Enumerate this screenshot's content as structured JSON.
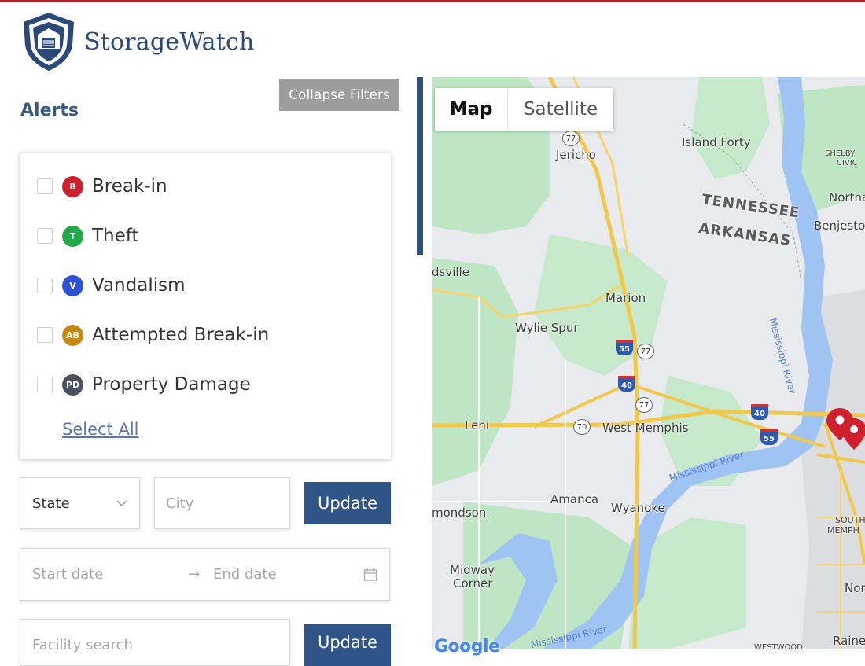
{
  "app": {
    "brand": "StorageWatch",
    "accent": "#2f5488",
    "top_bar_color": "#b3202f"
  },
  "filters": {
    "title": "Alerts",
    "collapse_label": "Collapse Filters",
    "alert_types": [
      {
        "badge": "B",
        "label": "Break-in",
        "color": "#d0202e",
        "checked": false
      },
      {
        "badge": "T",
        "label": "Theft",
        "color": "#23a84a",
        "checked": false
      },
      {
        "badge": "V",
        "label": "Vandalism",
        "color": "#2c52d6",
        "checked": false
      },
      {
        "badge": "AB",
        "label": "Attempted Break-in",
        "color": "#c68a12",
        "checked": false
      },
      {
        "badge": "PD",
        "label": "Property Damage",
        "color": "#4a5260",
        "checked": false
      }
    ],
    "select_all_label": "Select All",
    "state_select": {
      "value": "State",
      "icon": "chevron-down-icon"
    },
    "city_input": {
      "placeholder": "City",
      "value": ""
    },
    "update_label": "Update",
    "date_range": {
      "start_placeholder": "Start date",
      "separator": "→",
      "end_placeholder": "End date",
      "icon": "calendar-icon"
    },
    "facility_search": {
      "placeholder": "Facility search",
      "value": ""
    },
    "update_label_2": "Update"
  },
  "map": {
    "type_options": [
      {
        "label": "Map",
        "selected": true
      },
      {
        "label": "Satellite",
        "selected": false
      }
    ],
    "places": [
      "Jericho",
      "Island Forty",
      "Northa",
      "Benjestow",
      "dsville",
      "Marion",
      "Wylie Spur",
      "Lehi",
      "West Memphis",
      "Amanca",
      "Wyanoke",
      "mondson",
      "Midway",
      "Corner",
      "Nor",
      "Raine",
      "SOUTH",
      "MEMPH",
      "SHELBY",
      "CIVIC",
      "WESTWOOD"
    ],
    "state_labels": [
      "TENNESSEE",
      "ARKANSAS"
    ],
    "river_labels": [
      "Mississippi River",
      "Mississippi River",
      "Mississippi River"
    ],
    "route_shields": [
      "77",
      "77",
      "77",
      "70"
    ],
    "interstate_shields": [
      "55",
      "40",
      "40",
      "55"
    ],
    "attribution": "Google",
    "marker_color": "#d0202e"
  }
}
